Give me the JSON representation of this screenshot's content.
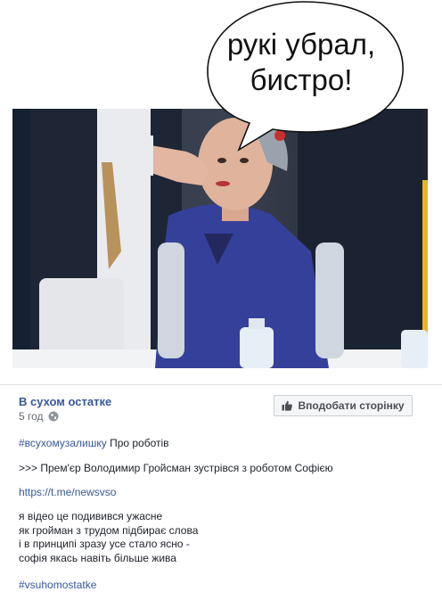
{
  "meme": {
    "bubble_line1": "рукі убрал,",
    "bubble_line2": "бистро!"
  },
  "post": {
    "page_name": "В сухом остатке",
    "time": "5 год",
    "privacy_icon": "globe-icon",
    "like_button_label": "Вподобати сторінку",
    "like_icon": "thumbs-up-icon",
    "hashtag1": "#всухомузалишку",
    "hashtag1_rest": " Про роботів",
    "line2": ">>> Прем'єр Володимир Гройсман зустрівся з роботом Софією",
    "link": "https://t.me/newsvso",
    "poem": [
      "я відео це подивився ужасне",
      "як гройман з трудом підбирає слова",
      "і в принципі зразу усе стало ясно -",
      "софія якась навіть більше жива"
    ],
    "hashtag2": "#vsuhomostatke"
  },
  "colors": {
    "link": "#365899",
    "text": "#1d2129",
    "meta": "#616770",
    "button_bg": "#f5f6f7"
  }
}
